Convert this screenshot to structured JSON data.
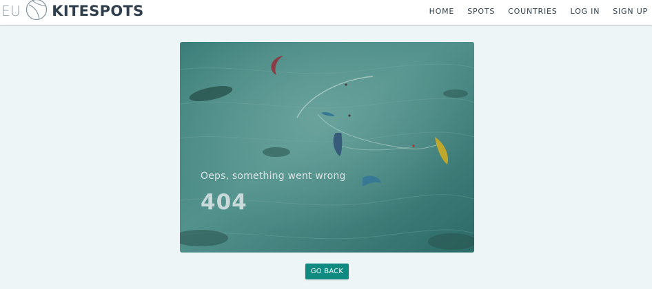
{
  "header": {
    "logo_prefix": "EU",
    "logo_name": "KITESPOTS",
    "nav": [
      {
        "label": "HOME"
      },
      {
        "label": "SPOTS"
      },
      {
        "label": "COUNTRIES"
      },
      {
        "label": "LOG IN"
      },
      {
        "label": "SIGN UP"
      }
    ]
  },
  "error": {
    "message": "Oeps, something went wrong",
    "code": "404"
  },
  "actions": {
    "go_back_label": "GO BACK"
  },
  "colors": {
    "accent": "#0f8a80",
    "brand_text": "#2f3e4c",
    "page_background": "#eef5f7"
  }
}
